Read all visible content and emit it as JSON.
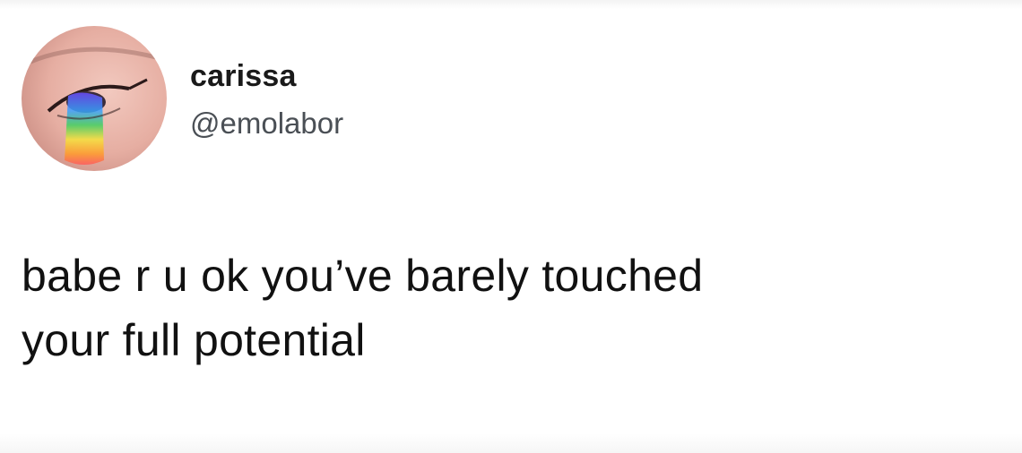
{
  "tweet": {
    "display_name": "carissa",
    "handle": "@emolabor",
    "text_line1": "babe r u ok you’ve barely touched",
    "text_line2": "your full potential"
  },
  "avatar": {
    "icon": "avatar-rainbow-eye"
  }
}
